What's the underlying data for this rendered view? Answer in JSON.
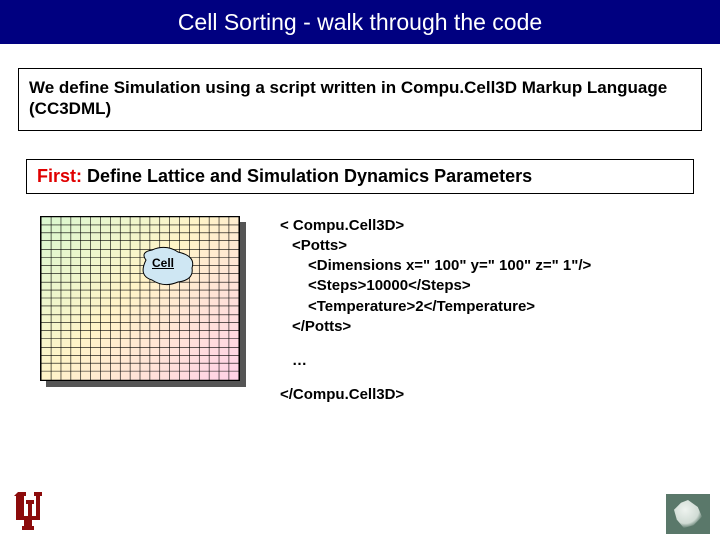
{
  "title": "Cell Sorting - walk through the code",
  "intro": "We define Simulation using a script written in Compu.Cell3D Markup Language (CC3DML)",
  "first": {
    "prefix": "First:",
    "rest": " Define Lattice and Simulation Dynamics Parameters"
  },
  "lattice": {
    "cell_label": "Cell"
  },
  "code": {
    "open_root": "< Compu.Cell3D>",
    "open_potts": "<Potts>",
    "dimensions": "<Dimensions x=\" 100\" y=\" 100\" z=\" 1\"/>",
    "steps": "<Steps>10000</Steps>",
    "temperature": "<Temperature>2</Temperature>",
    "close_potts": "</Potts>",
    "ellipsis": "…",
    "close_root": "</Compu.Cell3D>"
  }
}
